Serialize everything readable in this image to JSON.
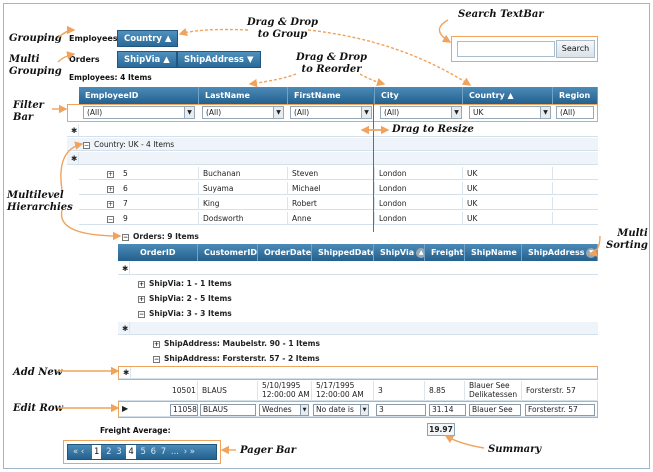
{
  "callouts": {
    "grouping": "Grouping",
    "multi_grouping": "Multi\nGrouping",
    "drag_drop_group": "Drag & Drop\nto Group",
    "drag_drop_reorder": "Drag & Drop\nto Reorder",
    "search_textbar": "Search TextBar",
    "filter_bar": "Filter\nBar",
    "drag_resize": "Drag to Resize",
    "multilevel": "Multilevel\nHierarchies",
    "multi_sorting": "Multi\nSorting",
    "add_new": "Add New",
    "edit_row": "Edit Row",
    "pager_bar": "Pager Bar",
    "summary": "Summary"
  },
  "group_bar_1": {
    "label": "Employees",
    "chip": "Country ▲"
  },
  "group_bar_2": {
    "label": "Orders",
    "chips": [
      "ShipVia ▲",
      "ShipAddress ▼"
    ]
  },
  "search": {
    "placeholder": "",
    "button": "Search"
  },
  "employees_count": "Employees: 4 Items",
  "columns": [
    "EmployeeID",
    "LastName",
    "FirstName",
    "City",
    "Country ▲",
    "Region"
  ],
  "filters": [
    "(All)",
    "(All)",
    "(All)",
    "(All)",
    "UK",
    "(All)"
  ],
  "new_row_marker": "✱",
  "country_group": "Country: UK - 4 Items",
  "employees": [
    {
      "id": "5",
      "last": "Buchanan",
      "first": "Steven",
      "city": "London",
      "country": "UK",
      "expander": "+"
    },
    {
      "id": "6",
      "last": "Suyama",
      "first": "Michael",
      "city": "London",
      "country": "UK",
      "expander": "+"
    },
    {
      "id": "7",
      "last": "King",
      "first": "Robert",
      "city": "London",
      "country": "UK",
      "expander": "+"
    },
    {
      "id": "9",
      "last": "Dodsworth",
      "first": "Anne",
      "city": "London",
      "country": "UK",
      "expander": "−"
    }
  ],
  "orders_count": "Orders: 9 Items",
  "order_columns": [
    "OrderID",
    "CustomerID",
    "OrderDate",
    "ShippedDate",
    "ShipVia",
    "Freight",
    "ShipName",
    "ShipAddress"
  ],
  "shipvia_groups": [
    "ShipVia: 1 - 1 Items",
    "ShipVia: 2 - 5 Items",
    "ShipVia: 3 - 3 Items"
  ],
  "shipaddress_groups": [
    "ShipAddress: Maubelstr. 90 - 1 Items",
    "ShipAddress: Forsterstr. 57 - 2 Items"
  ],
  "order_row": {
    "order_id": "10501",
    "customer": "BLAUS",
    "order_date": "5/10/1995 12:00:00 AM",
    "shipped": "5/17/1995 12:00:00 AM",
    "shipvia": "3",
    "freight": "8.85",
    "shipname": "Blauer See Delikatessen",
    "address": "Forsterstr. 57"
  },
  "edit_row": {
    "order_id": "11058",
    "customer": "BLAUS",
    "order_date": "Wednes",
    "shipped": "No date is",
    "shipvia": "3",
    "freight": "31.14",
    "shipname": "Blauer See",
    "address": "Forsterstr. 57"
  },
  "freight_average_label": "Freight Average:",
  "freight_average_value": "19.97",
  "pager": {
    "prev": "« ‹",
    "pages": [
      "1",
      "2",
      "3",
      "4",
      "5",
      "6",
      "7",
      "..."
    ],
    "current": "1",
    "next": "› »"
  },
  "colors": {
    "header": "#2b6a98",
    "accent": "#f0a35c"
  }
}
